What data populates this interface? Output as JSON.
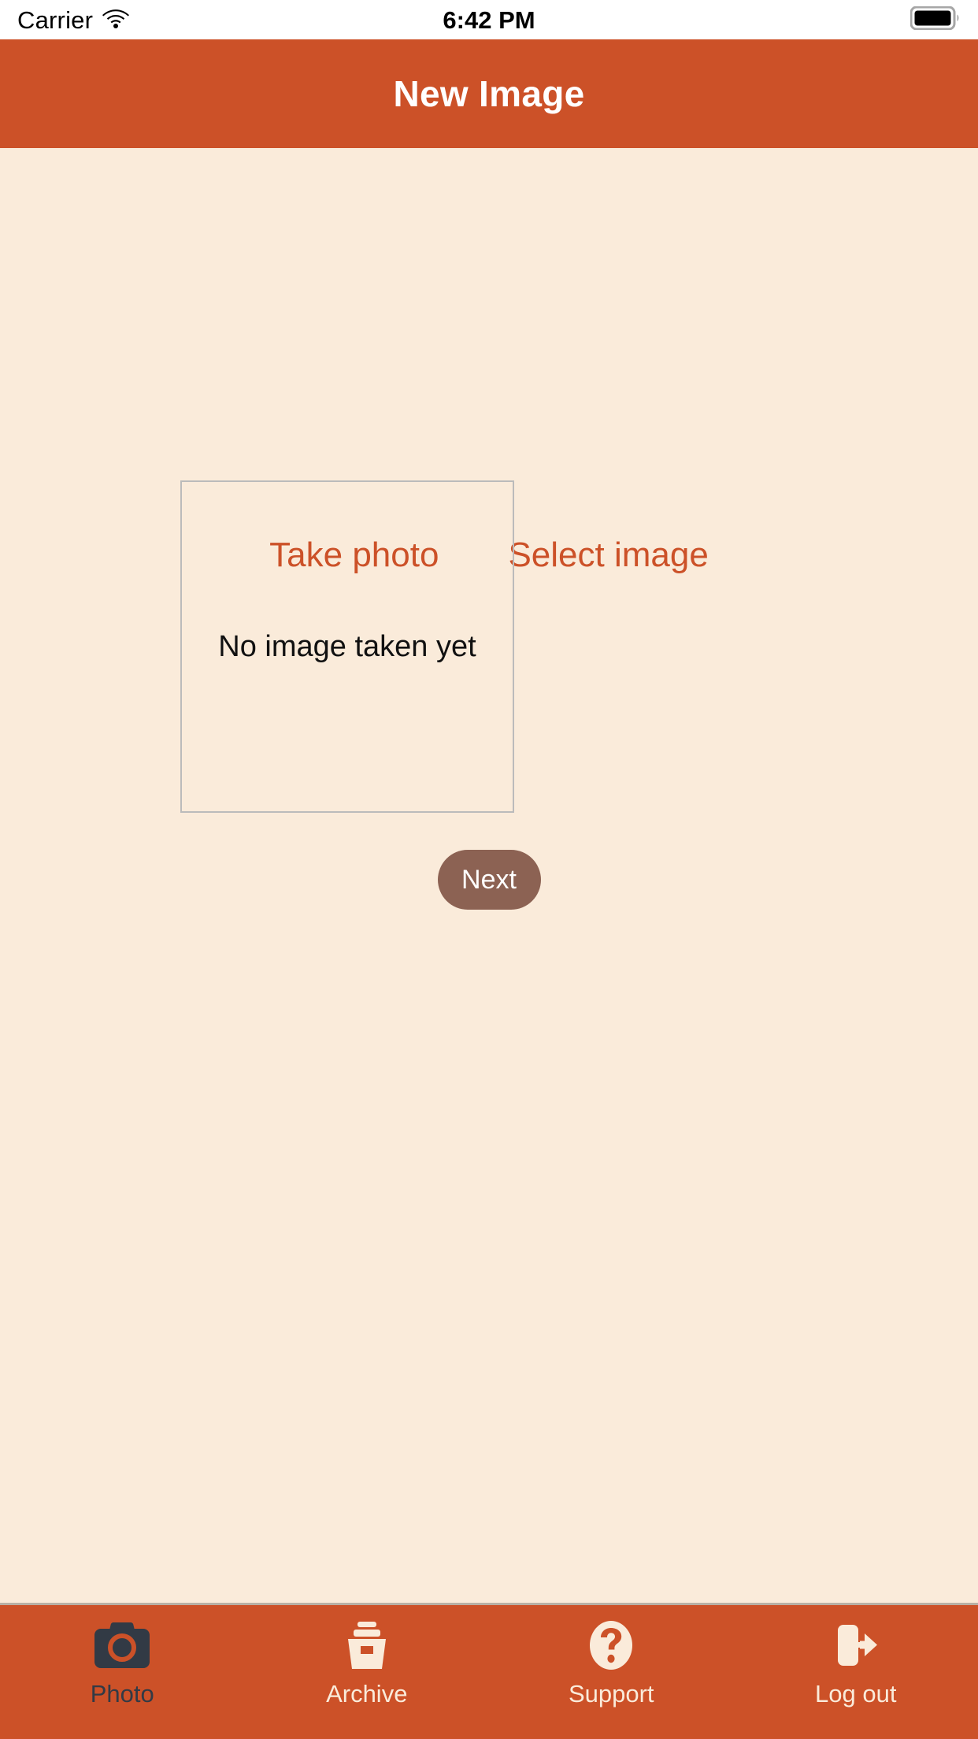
{
  "status_bar": {
    "carrier": "Carrier",
    "time": "6:42 PM",
    "wifi_icon": "wifi-icon",
    "battery_icon": "battery-full-icon"
  },
  "header": {
    "title": "New Image",
    "background_color": "#CC5128",
    "text_color": "#FFFFFF"
  },
  "main": {
    "background_color": "#FAEBDA",
    "actions": [
      {
        "label": "Take photo",
        "name": "take-photo-button"
      },
      {
        "label": "Select image",
        "name": "select-image-button"
      }
    ],
    "action_color": "#CC5128",
    "image_placeholder": {
      "text": "No image taken yet",
      "border_color": "#BBBBBB",
      "text_color": "#111111"
    },
    "next_button": {
      "label": "Next",
      "background_color": "#8C6253",
      "text_color": "#FFFFFF"
    }
  },
  "tab_bar": {
    "background_color": "#CC5128",
    "label_color": "#FAEBDA",
    "selected_label_color": "#323A45",
    "items": [
      {
        "label": "Photo",
        "icon": "camera-icon",
        "selected": true
      },
      {
        "label": "Archive",
        "icon": "archive-box-icon",
        "selected": false
      },
      {
        "label": "Support",
        "icon": "question-circle-icon",
        "selected": false
      },
      {
        "label": "Log out",
        "icon": "logout-arrow-icon",
        "selected": false
      }
    ]
  }
}
